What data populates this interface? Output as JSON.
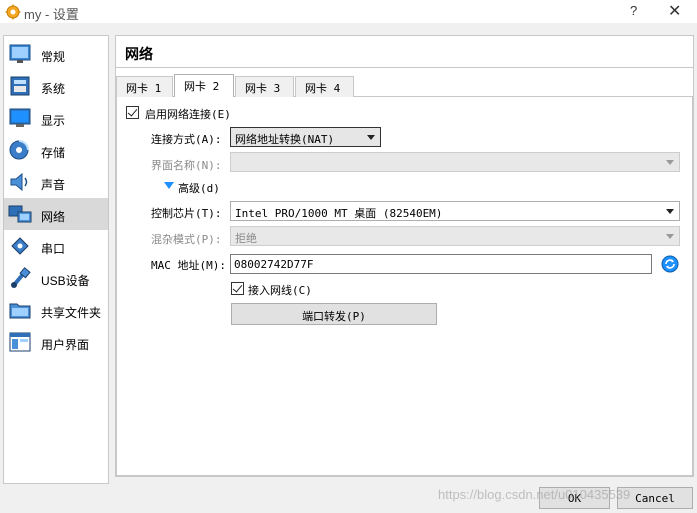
{
  "window": {
    "title": "my - 设置",
    "help": "?",
    "close": "✕"
  },
  "sidebar": {
    "items": [
      {
        "label": "常规",
        "icon": "general-icon"
      },
      {
        "label": "系统",
        "icon": "system-icon"
      },
      {
        "label": "显示",
        "icon": "display-icon"
      },
      {
        "label": "存储",
        "icon": "storage-icon"
      },
      {
        "label": "声音",
        "icon": "audio-icon"
      },
      {
        "label": "网络",
        "icon": "network-icon",
        "selected": true
      },
      {
        "label": "串口",
        "icon": "serial-port-icon"
      },
      {
        "label": "USB设备",
        "icon": "usb-icon"
      },
      {
        "label": "共享文件夹",
        "icon": "shared-folder-icon"
      },
      {
        "label": "用户界面",
        "icon": "user-interface-icon"
      }
    ]
  },
  "header": {
    "title": "网络"
  },
  "tabs": [
    "网卡 1",
    "网卡 2",
    "网卡 3",
    "网卡 4"
  ],
  "active_tab": "网卡 2",
  "form": {
    "enable_label": "启用网络连接(E)",
    "attached_label": "连接方式(A):",
    "attached_value": "网络地址转换(NAT)",
    "name_label": "界面名称(N):",
    "name_value": "",
    "advanced_label": "高级(d)",
    "adapter_label": "控制芯片(T):",
    "adapter_value": "Intel PRO/1000 MT 桌面 (82540EM)",
    "promisc_label": "混杂模式(P):",
    "promisc_value": "拒绝",
    "mac_label": "MAC 地址(M):",
    "mac_value": "08002742D77F",
    "cable_label": "接入网线(C)",
    "port_forward_label": "端口转发(P)"
  },
  "footer": {
    "ok_label": "OK",
    "cancel_label": "Cancel"
  },
  "watermark": "https://blog.csdn.net/u010435539",
  "colors": {
    "accent_blue": "#1e90ff",
    "selected_bg": "#d9d9d9"
  }
}
